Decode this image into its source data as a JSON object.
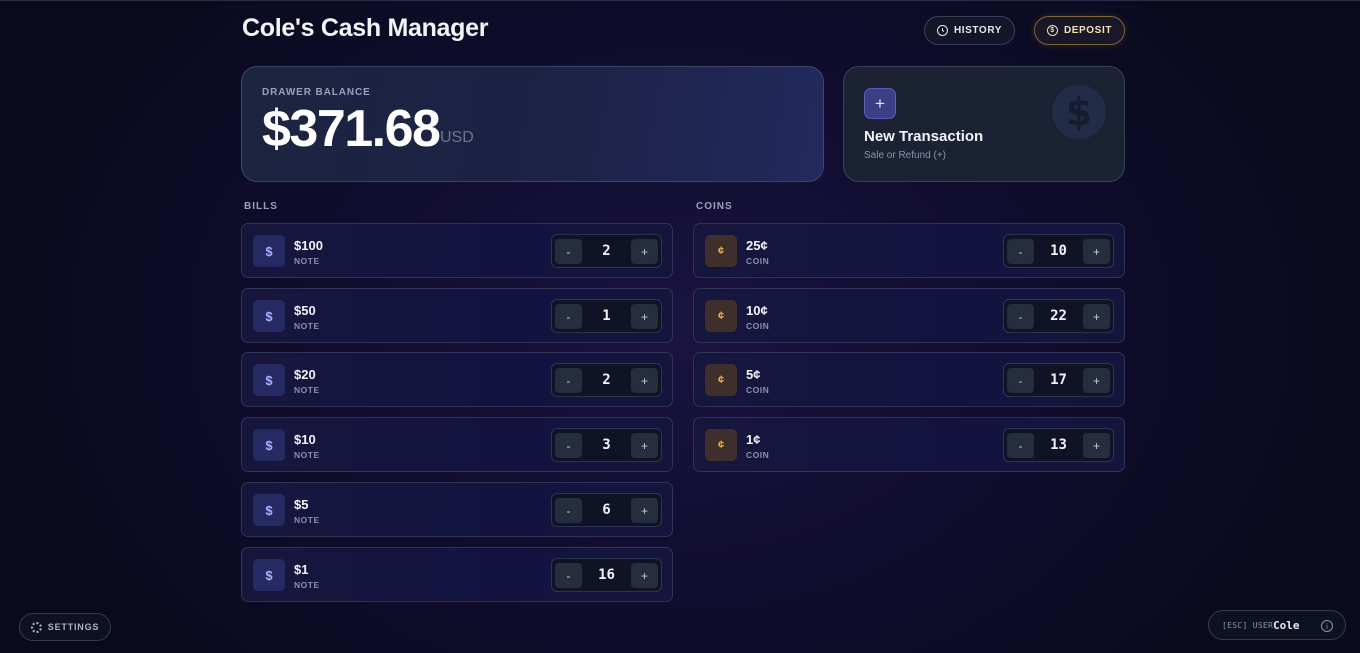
{
  "header": {
    "title": "Cole's Cash Manager",
    "history_label": "HISTORY",
    "deposit_label": "DEPOSIT",
    "history_icon": "clock-icon",
    "deposit_icon": "dollar-coin-icon"
  },
  "balance": {
    "label": "DRAWER BALANCE",
    "amount": "$371.68",
    "currency": "USD"
  },
  "transaction": {
    "plus": "+",
    "title": "New Transaction",
    "subtitle": "Sale or Refund (+)",
    "watermark_icon": "dollar-coin-icon"
  },
  "bills": {
    "title": "BILLS",
    "items": [
      {
        "symbol": "$",
        "denomination": "$100",
        "kind": "NOTE",
        "count": "2"
      },
      {
        "symbol": "$",
        "denomination": "$50",
        "kind": "NOTE",
        "count": "1"
      },
      {
        "symbol": "$",
        "denomination": "$20",
        "kind": "NOTE",
        "count": "2"
      },
      {
        "symbol": "$",
        "denomination": "$10",
        "kind": "NOTE",
        "count": "3"
      },
      {
        "symbol": "$",
        "denomination": "$5",
        "kind": "NOTE",
        "count": "6"
      },
      {
        "symbol": "$",
        "denomination": "$1",
        "kind": "NOTE",
        "count": "16"
      }
    ]
  },
  "coins": {
    "title": "COINS",
    "items": [
      {
        "symbol": "¢",
        "denomination": "25¢",
        "kind": "COIN",
        "count": "10"
      },
      {
        "symbol": "¢",
        "denomination": "10¢",
        "kind": "COIN",
        "count": "22"
      },
      {
        "symbol": "¢",
        "denomination": "5¢",
        "kind": "COIN",
        "count": "17"
      },
      {
        "symbol": "¢",
        "denomination": "1¢",
        "kind": "COIN",
        "count": "13"
      }
    ]
  },
  "stepper": {
    "minus": "-",
    "plus": "+"
  },
  "footer": {
    "settings_label": "SETTINGS",
    "user_label": "[ESC] USER:",
    "user_name": "Cole"
  },
  "colors": {
    "accent": "#3b3f86",
    "bill_icon": "#a7b1ff",
    "coin_icon": "#f2b640",
    "deposit_border": "#7a6536"
  }
}
